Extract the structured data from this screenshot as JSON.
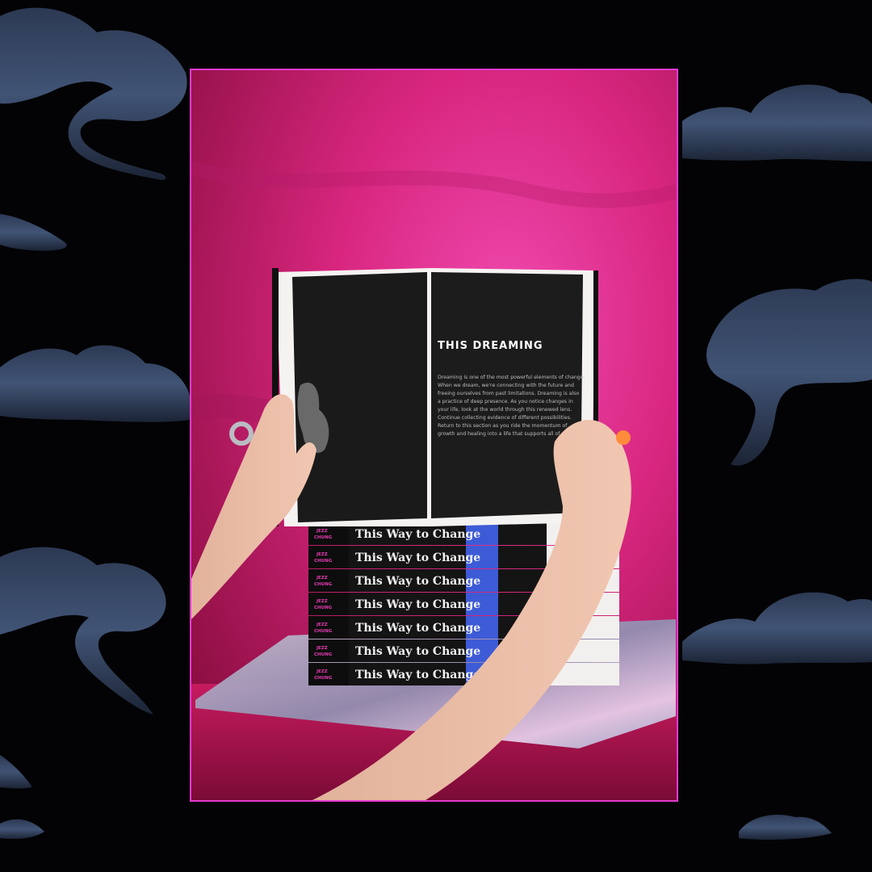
{
  "scene": {
    "description_colors": {
      "backdrop": "#030305",
      "cloud": "#3f5273",
      "frame_border": "#e23bd1",
      "velvet": "#d8216f",
      "book_black": "#161616"
    }
  },
  "open_book": {
    "heading": "THIS DREAMING",
    "body_lines": [
      "Dreaming is one of the most powerful elements of change.",
      "When we dream, we're connecting with the future and",
      "freeing ourselves from past limitations. Dreaming is also",
      "a practice of deep presence. As you notice changes in",
      "your life, look at the world through this renewed lens.",
      "Continue collecting evidence of different possibilities.",
      "Return to this section as you ride the momentum of",
      "growth and healing into a life that supports all of you."
    ]
  },
  "book_stack": {
    "spine_title": "This Way to Change",
    "author_line1": "JEZZ",
    "author_line2": "CHUNG",
    "count": 7
  }
}
